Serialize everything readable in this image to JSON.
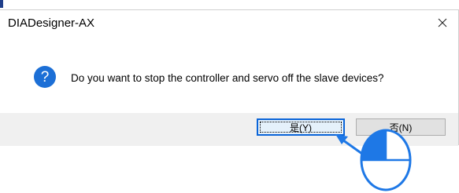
{
  "window": {
    "title": "DIADesigner-AX",
    "close_icon": "close-icon"
  },
  "dialog": {
    "icon": "question-icon",
    "icon_glyph": "?",
    "message": "Do you want to stop the controller and servo off the slave devices?"
  },
  "buttons": {
    "yes_label": "是(Y)",
    "no_label": "否(N)"
  },
  "annotation": {
    "pointer": "arrow-icon",
    "mouse": "mouse-left-click-icon"
  },
  "colors": {
    "accent": "#0a64d8",
    "icon_blue": "#1c6fd6",
    "annotation_blue": "#1e78e6",
    "footer": "#f0f0f0"
  }
}
